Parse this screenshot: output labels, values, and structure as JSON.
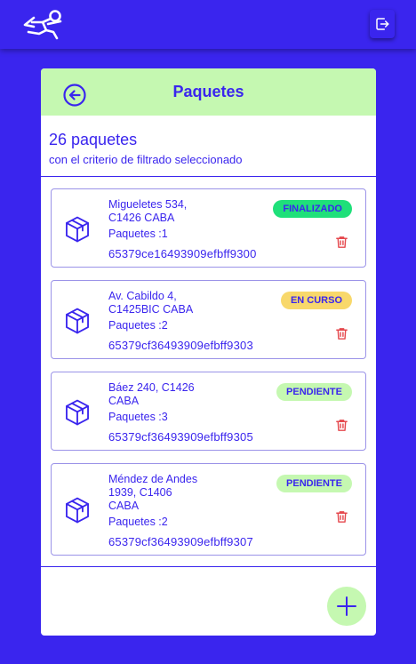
{
  "header": {
    "logo_icon": "runner-logo-icon",
    "logout_icon": "logout-icon"
  },
  "panel": {
    "title": "Paquetes",
    "back_icon": "arrow-left-circle-icon",
    "count_text": "26 paquetes",
    "criteria_text": "con el criterio de filtrado seleccionado"
  },
  "packages": [
    {
      "addr1": "Migueletes 534,",
      "addr2": "C1426 CABA",
      "addr3": "",
      "packages_label": "Paquetes :1",
      "id": "65379ce16493909efbff9300",
      "status": "FINALIZADO",
      "status_color": "#1fe07a"
    },
    {
      "addr1": "Av. Cabildo 4,",
      "addr2": "C1425BIC CABA",
      "addr3": "",
      "packages_label": "Paquetes :2",
      "id": "65379cf36493909efbff9303",
      "status": "EN CURSO",
      "status_color": "#f8d86b"
    },
    {
      "addr1": "Báez 240, C1426",
      "addr2": "CABA",
      "addr3": "",
      "packages_label": "Paquetes :3",
      "id": "65379cf36493909efbff9305",
      "status": "PENDIENTE",
      "status_color": "#c5f8b1"
    },
    {
      "addr1": "Méndez de Andes",
      "addr2": "1939, C1406",
      "addr3": "CABA",
      "packages_label": "Paquetes :2",
      "id": "65379cf36493909efbff9307",
      "status": "PENDIENTE",
      "status_color": "#c5f8b1"
    }
  ],
  "icons": {
    "package": "box-icon",
    "delete": "trash-icon",
    "add": "plus-icon"
  },
  "colors": {
    "brand": "#3a25ee",
    "accent": "#c5f8b1",
    "danger": "#e5484d"
  }
}
